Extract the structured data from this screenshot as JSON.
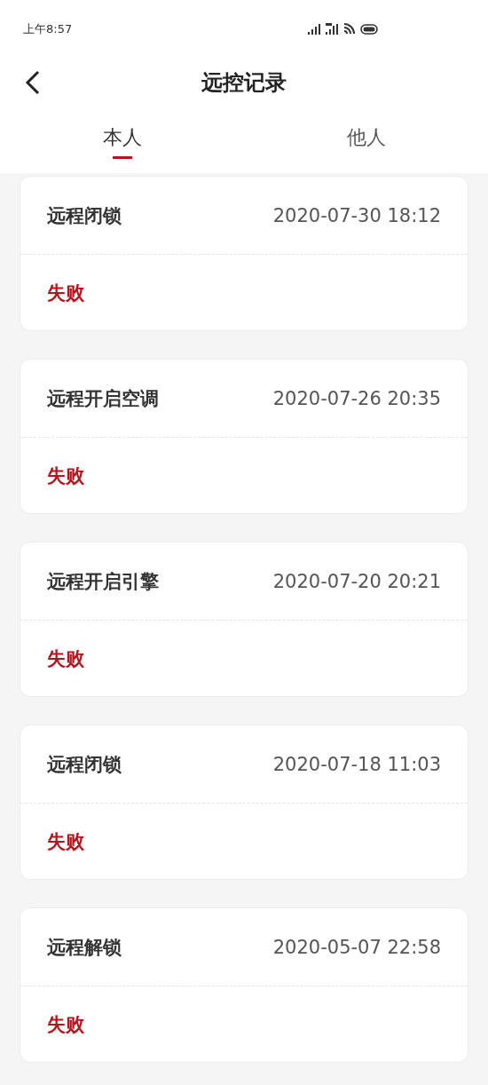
{
  "status_bar": {
    "time": "上午8:57"
  },
  "header": {
    "title": "远控记录"
  },
  "tabs": [
    {
      "label": "本人",
      "selected": true
    },
    {
      "label": "他人",
      "selected": false
    }
  ],
  "records": [
    {
      "action": "远程闭锁",
      "time": "2020-07-30 18:12",
      "result": "失败"
    },
    {
      "action": "远程开启空调",
      "time": "2020-07-26 20:35",
      "result": "失败"
    },
    {
      "action": "远程开启引擎",
      "time": "2020-07-20 20:21",
      "result": "失败"
    },
    {
      "action": "远程闭锁",
      "time": "2020-07-18 11:03",
      "result": "失败"
    },
    {
      "action": "远程解锁",
      "time": "2020-05-07 22:58",
      "result": "失败"
    }
  ]
}
